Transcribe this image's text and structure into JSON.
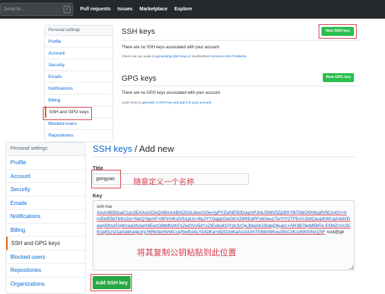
{
  "header": {
    "search_placeholder": "Jump to...",
    "search_key": "/",
    "nav": [
      "Pull requests",
      "Issues",
      "Marketplace",
      "Explore"
    ]
  },
  "upper": {
    "sidebar": {
      "heading": "Personal settings",
      "items": [
        "Profile",
        "Account",
        "Security",
        "Emails",
        "Notifications",
        "Billing",
        "SSH and GPG keys",
        "Blocked users",
        "Repositories"
      ]
    },
    "ssh": {
      "title": "SSH keys",
      "button": "New SSH key",
      "empty": "There are no SSH keys associated with your account.",
      "guide_pre": "Check out our guide to ",
      "guide_link1": "generating SSH keys",
      "guide_mid": " or troubleshoot ",
      "guide_link2": "common SSH Problems",
      "guide_post": "."
    },
    "gpg": {
      "title": "GPG keys",
      "button": "New GPG key",
      "empty": "There are no GPG keys associated with your account.",
      "guide_pre": "Learn how to ",
      "guide_link": "generate a GPG key and add it to your account",
      "guide_post": "."
    }
  },
  "lower": {
    "sidebar": {
      "heading": "Personal settings",
      "items": [
        "Profile",
        "Account",
        "Security",
        "Emails",
        "Notifications",
        "Billing",
        "SSH and GPG keys",
        "Blocked users",
        "Repositories",
        "Organizations"
      ]
    },
    "heading_crumb": "SSH keys",
    "heading_sep": " / ",
    "heading_page": "Add new",
    "title_label": "Title",
    "title_value": "gongyao",
    "title_annotation": "随意定义一个名称",
    "key_label": "Key",
    "key_prefix": "ssh-rsa",
    "key_body": "AAAAB3NzaC1yc2EAAAADAQABAAABAQCkLibocGGe+jyPYZwNE50DoqmPJnkJSWz5Zjz8SYBiT6bOtfA8spR/9CmGV+hmEk/E5bTbKx2sr+NeQYqoXF+8PVmKsIV51pUc+8pJYYOqqzOwGKXZ6REdPFo6SeuzTwYtY2TFEoY2lolCeupKWUqA4dVDew/j5fmAFqWcwa3fsIwH3EezO8tMNzKFzZwOVv5dYxZtEx6uKQYdcSrQeJ6plAKI2kdqQ6ya/c+AR3B76pM5ltFix E5MZcVc35EcqElLh21aXdd/uepcXy76Rk0e/ISrMCcq/5wEdALYDIDEa+dQO2oKaAoJcUmTEBl0rl9hos3ifnCxK1d5KSINxQ5F",
    "key_suffix": " root@git",
    "key_annotation": "将其复制公钥粘贴到此位置",
    "submit": "Add SSH key"
  },
  "colors": {
    "header_bg": "#24292e",
    "link": "#0366d6",
    "green": "#2cbe4e",
    "annotation_red": "#d73a49",
    "selected_marker": "#e36209"
  }
}
